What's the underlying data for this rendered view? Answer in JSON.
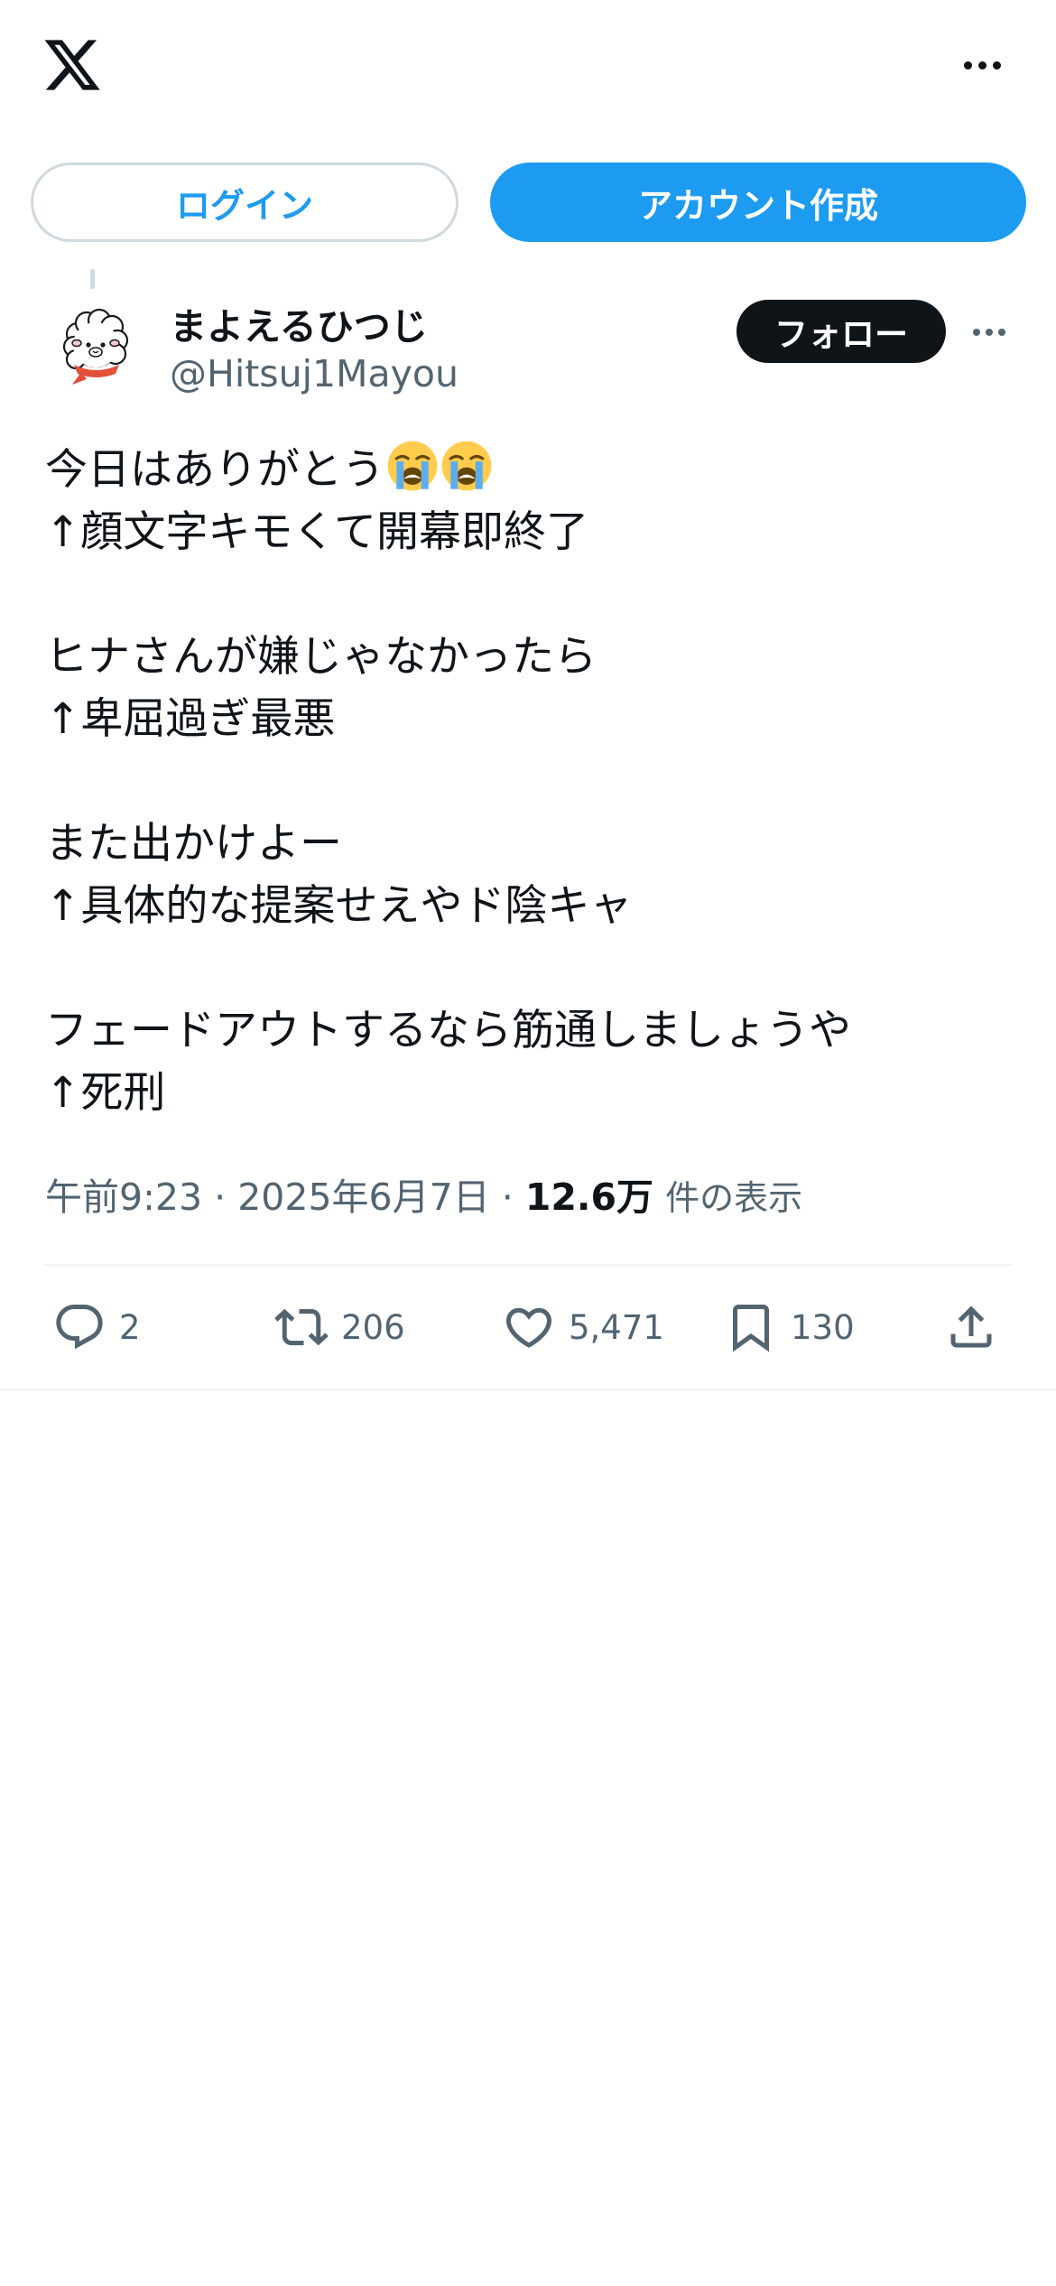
{
  "header": {
    "logo_icon": "x-logo-icon",
    "more_icon": "more-horizontal-icon"
  },
  "auth": {
    "login_label": "ログイン",
    "signup_label": "アカウント作成",
    "accent_color": "#1d9bf0"
  },
  "tweet": {
    "author": {
      "display_name": "まよえるひつじ",
      "handle": "@Hitsuj1Mayou",
      "avatar_icon": "sheep-avatar-icon"
    },
    "follow_label": "フォロー",
    "lines": [
      "今日はありがとう",
      "↑顔文字キモくて開幕即終了",
      "",
      "ヒナさんが嫌じゃなかったら",
      "↑卑屈過ぎ最悪",
      "",
      "また出かけよー",
      "↑具体的な提案せえやド陰キャ",
      "",
      "フェードアウトするなら筋通しましょうや",
      "↑死刑"
    ],
    "first_line_emoji": [
      "loudly-crying-face-emoji",
      "loudly-crying-face-emoji"
    ],
    "time": "午前9:23",
    "separator": "·",
    "date": "2025年6月7日",
    "views_count": "12.6万",
    "views_label": "件の表示",
    "stats": {
      "replies": "2",
      "retweets": "206",
      "likes": "5,471",
      "bookmarks": "130"
    }
  }
}
